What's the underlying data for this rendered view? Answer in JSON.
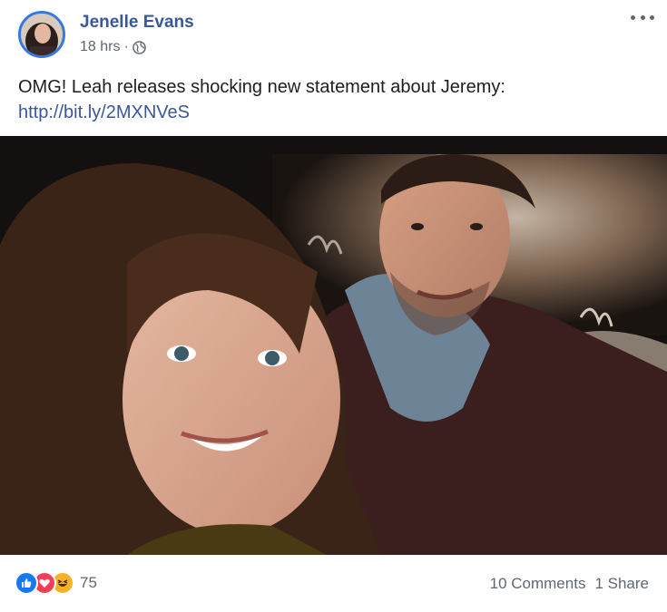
{
  "post": {
    "author": "Jenelle Evans",
    "time": "18 hrs",
    "separator": "·",
    "privacy_icon": "globe-icon",
    "more_icon": "more-options-icon",
    "text": "OMG! Leah releases shocking new statement about Jeremy:",
    "link": "http://bit.ly/2MXNVeS"
  },
  "footer": {
    "reaction_icons": [
      "like-icon",
      "love-icon",
      "haha-icon"
    ],
    "reaction_count": "75",
    "comments": "10 Comments",
    "shares": "1 Share"
  },
  "colors": {
    "author": "#385898",
    "link": "#385898",
    "meta": "#606770",
    "like": "#1877f2",
    "love": "#f33e58",
    "haha": "#f7b125"
  }
}
